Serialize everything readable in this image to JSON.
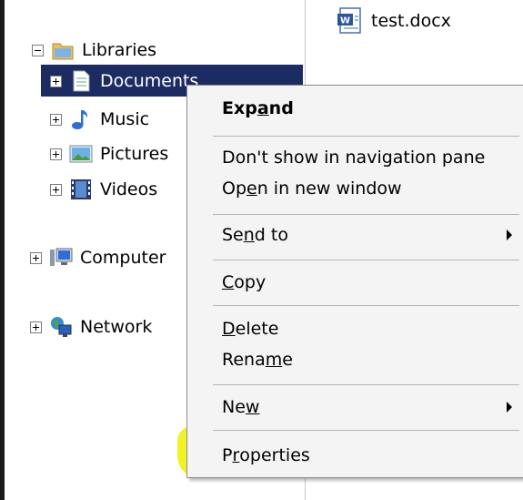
{
  "file": {
    "name": "test.docx",
    "icon": "word-document-icon"
  },
  "tree": {
    "libraries": {
      "label": "Libraries",
      "icon": "libraries-folder-icon",
      "expander": "collapse"
    },
    "children": [
      {
        "label": "Documents",
        "icon": "documents-icon",
        "selected": true
      },
      {
        "label": "Music",
        "icon": "music-icon"
      },
      {
        "label": "Pictures",
        "icon": "pictures-icon"
      },
      {
        "label": "Videos",
        "icon": "videos-icon"
      }
    ],
    "computer": {
      "label": "Computer",
      "icon": "computer-icon"
    },
    "network": {
      "label": "Network",
      "icon": "network-icon"
    }
  },
  "context_menu": {
    "expand": {
      "pre": "Exp",
      "key": "a",
      "post": "nd"
    },
    "dont_show": "Don't show in navigation pane",
    "open_new": {
      "pre": "Op",
      "key": "e",
      "post": "n in new window"
    },
    "send_to": {
      "pre": "Se",
      "key": "n",
      "post": "d to"
    },
    "copy": {
      "pre": "",
      "key": "C",
      "post": "opy"
    },
    "delete": {
      "pre": "",
      "key": "D",
      "post": "elete"
    },
    "rename": {
      "pre": "Rena",
      "key": "m",
      "post": "e"
    },
    "new": {
      "pre": "Ne",
      "key": "w",
      "post": ""
    },
    "properties": {
      "pre": "P",
      "key": "r",
      "post": "operties"
    }
  },
  "colors": {
    "selection": "#1c2c62",
    "highlighter": "#eeee00"
  }
}
